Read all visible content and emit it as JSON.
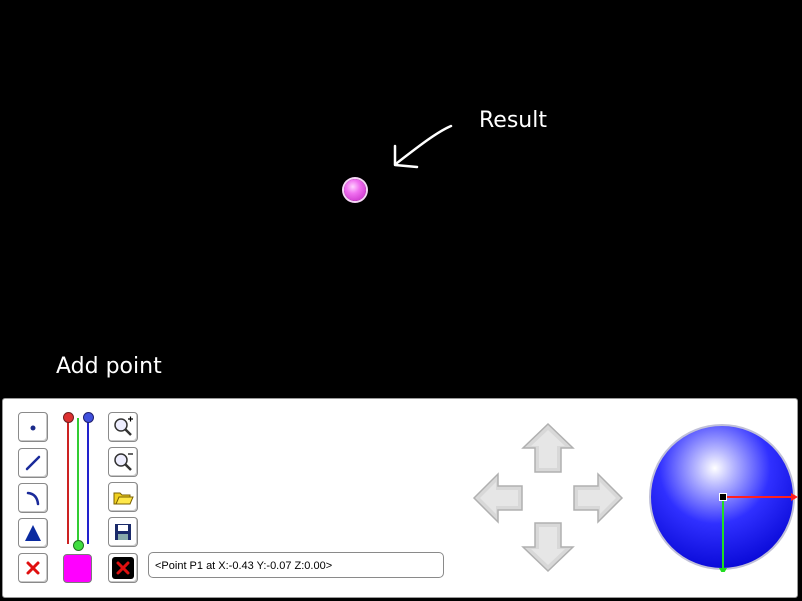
{
  "annotations": {
    "result_label": "Result",
    "add_point_label": "Add point"
  },
  "toolbar": {
    "tools": [
      {
        "name": "add-point",
        "icon": "dot-icon"
      },
      {
        "name": "add-line",
        "icon": "line-icon"
      },
      {
        "name": "add-arc",
        "icon": "arc-icon"
      },
      {
        "name": "add-triangle",
        "icon": "triangle-icon"
      },
      {
        "name": "delete",
        "icon": "red-x-icon"
      }
    ],
    "view_tools": [
      {
        "name": "zoom-in",
        "icon": "zoom-in-icon"
      },
      {
        "name": "zoom-out",
        "icon": "zoom-out-icon"
      },
      {
        "name": "open",
        "icon": "folder-icon"
      },
      {
        "name": "save",
        "icon": "floppy-disk-icon"
      },
      {
        "name": "clear",
        "icon": "black-x-icon"
      }
    ]
  },
  "colors": {
    "point": "#e040e0",
    "swatch": "#ff00ff",
    "slider_red": "#cc2222",
    "slider_green": "#33cc33",
    "slider_blue": "#2222cc",
    "globe": "#1010ff"
  },
  "status": {
    "text": "<Point P1 at X:-0.43 Y:-0.07 Z:0.00>"
  }
}
